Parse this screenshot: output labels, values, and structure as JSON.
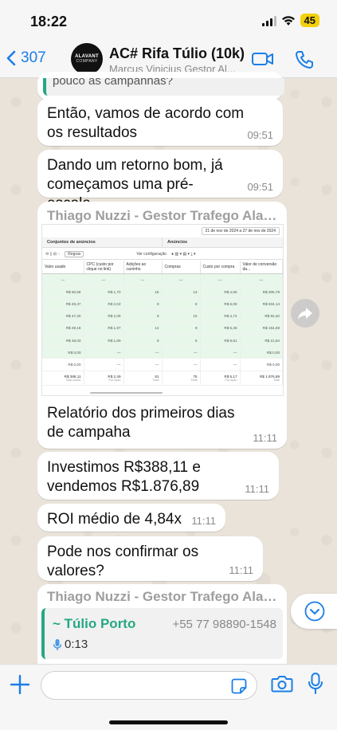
{
  "status_bar": {
    "time": "18:22",
    "battery": "45"
  },
  "header": {
    "back_count": "307",
    "avatar_line1": "ALAVANT",
    "avatar_line2": "COMPANY",
    "title": "AC# Rifa Túlio (10k)",
    "subtitle": "Marcus Vinicius Gestor Al..."
  },
  "messages": {
    "quoted_partial": "pouco as campanhas?",
    "m1": {
      "text": "Então, vamos de acordo com os resultados",
      "time": "09:51"
    },
    "m2": {
      "text": "Dando um retorno bom, já começamos uma pré-escala",
      "time": "09:51"
    },
    "m3": {
      "sender": "Thiago Nuzzi - Gestor Trafego Alav...",
      "caption": "Relatório dos primeiros dias de campaha",
      "time": "11:11"
    },
    "m4": {
      "text": "Investimos R$388,11 e vendemos R$1.876,89",
      "time": "11:11"
    },
    "m5": {
      "text": "ROI médio de 4,84x",
      "time": "11:11"
    },
    "m6": {
      "text": "Pode nos confirmar os valores?",
      "time": "11:11"
    },
    "m7": {
      "sender": "Thiago Nuzzi - Gestor Trafego Alav...",
      "contact_name": "~ Túlio Porto",
      "contact_phone": "+55 77 98890-1548",
      "audio_duration": "0:13"
    }
  },
  "report": {
    "date_range": "21 de nov de 2024 a 27 de nov de 2024",
    "section_left": "Conjuntos de anúncios",
    "section_right": "Anúncios",
    "toolbar_rules": "Regras",
    "toolbar_config": "Ver configuração",
    "columns": [
      "Valor usado",
      "CPC (custo por clique no link)",
      "Adições ao carrinho",
      "Compras",
      "Custo por compra",
      "Valor de conversão da..."
    ],
    "rows": [
      [
        "—",
        "—",
        "—",
        "—",
        "—",
        "—"
      ],
      [
        "R$ 60,56",
        "R$ 1,70",
        "16",
        "13",
        "R$ 4,66",
        "R$ 306,79"
      ],
      [
        "R$ 48,47",
        "R$ 2,02",
        "8",
        "8",
        "R$ 6,06",
        "R$ 634,14"
      ],
      [
        "R$ 47,20",
        "R$ 2,05",
        "8",
        "10",
        "R$ 4,72",
        "R$ 92,40"
      ],
      [
        "R$ 49,16",
        "R$ 1,97",
        "14",
        "9",
        "R$ 5,46",
        "R$ 154,68"
      ],
      [
        "R$ 48,03",
        "R$ 1,69",
        "8",
        "5",
        "R$ 9,61",
        "R$ 21,54"
      ],
      [
        "R$ 0,00",
        "—",
        "—",
        "—",
        "—",
        "R$ 0,00"
      ],
      [
        "R$ 0,00",
        "—",
        "—",
        "—",
        "—",
        "R$ 0,00"
      ]
    ],
    "totals": [
      "R$ 388,11",
      "R$ 2,49",
      "81",
      "75",
      "R$ 5,17",
      "R$ 1.876,89"
    ],
    "totals_sub": [
      "Total usado",
      "Por ação",
      "Total",
      "Total",
      "Por ação",
      "Total"
    ]
  },
  "colors": {
    "accent": "#1a7ee8",
    "whatsapp_green": "#25a883",
    "battery": "#f2d00c"
  }
}
